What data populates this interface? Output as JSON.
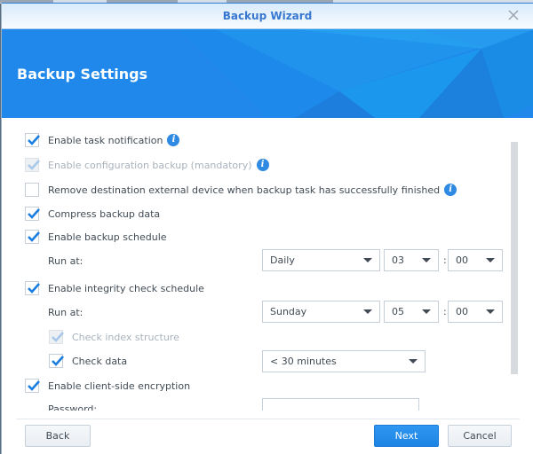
{
  "window": {
    "title": "Backup Wizard",
    "close_icon": "close-icon"
  },
  "banner": {
    "heading": "Backup Settings"
  },
  "options": {
    "task_notification": {
      "label": "Enable task notification",
      "checked": true,
      "disabled": false,
      "info": true
    },
    "config_backup": {
      "label": "Enable configuration backup (mandatory)",
      "checked": true,
      "disabled": true,
      "info": true
    },
    "remove_external": {
      "label": "Remove destination external device when backup task has successfully finished",
      "checked": false,
      "disabled": false,
      "info": true
    },
    "compress": {
      "label": "Compress backup data",
      "checked": true,
      "disabled": false
    },
    "backup_schedule": {
      "label": "Enable backup schedule",
      "checked": true,
      "disabled": false,
      "run_at_label": "Run at:",
      "frequency": "Daily",
      "hour": "03",
      "separator": ":",
      "minute": "00"
    },
    "integrity_schedule": {
      "label": "Enable integrity check schedule",
      "checked": true,
      "disabled": false,
      "run_at_label": "Run at:",
      "day": "Sunday",
      "hour": "05",
      "separator": ":",
      "minute": "00"
    },
    "check_index": {
      "label": "Check index structure",
      "checked": true,
      "disabled": true
    },
    "check_data": {
      "label": "Check data",
      "checked": true,
      "disabled": false,
      "duration": "< 30 minutes"
    },
    "encryption": {
      "label": "Enable client-side encryption",
      "checked": true,
      "disabled": false,
      "password_label": "Password:",
      "password_value": ""
    }
  },
  "footer": {
    "back_label": "Back",
    "next_label": "Next",
    "cancel_label": "Cancel"
  },
  "colors": {
    "accent": "#1f88ea",
    "title_text": "#3777cf",
    "check": "#1a7ee0",
    "check_disabled": "#a8c8ea"
  }
}
